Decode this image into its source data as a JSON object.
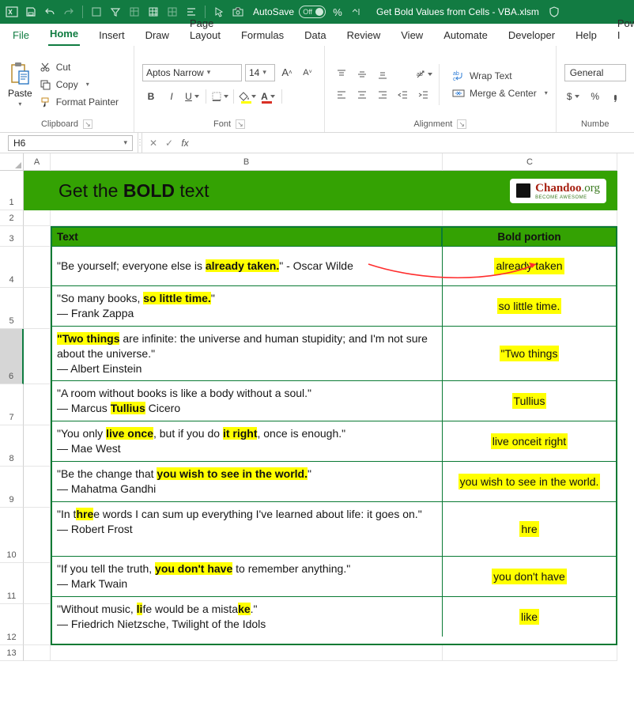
{
  "titlebar": {
    "autosave_label": "AutoSave",
    "autosave_state": "Off",
    "percent_icon": "%",
    "document_title": "Get Bold Values from Cells - VBA.xlsm"
  },
  "menutabs": {
    "file": "File",
    "home": "Home",
    "insert": "Insert",
    "draw": "Draw",
    "page_layout": "Page Layout",
    "formulas": "Formulas",
    "data": "Data",
    "review": "Review",
    "view": "View",
    "automate": "Automate",
    "developer": "Developer",
    "help": "Help",
    "power": "Power I"
  },
  "ribbon": {
    "clipboard": {
      "label": "Clipboard",
      "paste": "Paste",
      "cut": "Cut",
      "copy": "Copy",
      "format_painter": "Format Painter"
    },
    "font": {
      "label": "Font",
      "name": "Aptos Narrow",
      "size": "14",
      "bold": "B",
      "italic": "I",
      "underline": "U",
      "font_letter": "A"
    },
    "alignment": {
      "label": "Alignment",
      "wrap": "Wrap Text",
      "merge": "Merge & Center"
    },
    "number": {
      "label": "Numbe",
      "format": "General",
      "currency": "$",
      "percent": "%"
    }
  },
  "namebox": "H6",
  "formula": "",
  "colheaders": {
    "A": "A",
    "B": "B",
    "C": "C"
  },
  "rowheaders": [
    "1",
    "2",
    "3",
    "4",
    "5",
    "6",
    "7",
    "8",
    "9",
    "10",
    "11",
    "12",
    "13"
  ],
  "banner": {
    "pre": "Get the ",
    "bold": "BOLD",
    "post": " text",
    "logo_name": "Chandoo",
    "logo_tld": ".org",
    "logo_sub": "BECOME AWESOME"
  },
  "table": {
    "headers": {
      "text": "Text",
      "bold": "Bold portion"
    },
    "rows": [
      {
        "pre": "\"Be yourself; everyone else is ",
        "hl": "already taken.",
        "post": "\" - Oscar Wilde",
        "result": "already taken"
      },
      {
        "pre": "\"So many books, ",
        "hl": "so little time.",
        "post": "\"",
        "author": "― Frank Zappa",
        "result": "so little time."
      },
      {
        "pre": "",
        "hl": "\"Two things",
        "post": " are infinite: the universe and human stupidity; and I'm not sure about the universe.\"",
        "author": "― Albert Einstein",
        "result": "\"Two things"
      },
      {
        "pre": "\"A room without books is like a body without a soul.\"",
        "author_pre": "― Marcus ",
        "hl": "Tullius",
        "author_post": " Cicero",
        "result": "Tullius"
      },
      {
        "pre": "\"You only ",
        "hl": "live once",
        "mid": ", but if you do ",
        "hl2": "it right",
        "post": ", once is enough.\"",
        "author": "― Mae West",
        "result": "live onceit right"
      },
      {
        "pre": "\"Be the change that ",
        "hl": "you wish to see in the world.",
        "post": "\"",
        "author": "― Mahatma Gandhi",
        "result": "you wish to see in the world."
      },
      {
        "pre": "\"In t",
        "hl": "hre",
        "post": "e words I can sum up everything I've learned about life: it goes on.\"",
        "author": "― Robert Frost",
        "result": "hre"
      },
      {
        "pre": "\"If you tell the truth, ",
        "hl": "you don't have",
        "post": " to remember anything.\"",
        "author": "― Mark Twain",
        "result": "you don't have"
      },
      {
        "pre": "\"Without music, ",
        "hl": "li",
        "mid": "fe would be a mista",
        "hl2": "ke",
        "post": ".\"",
        "author": "― Friedrich Nietzsche, Twilight of the Idols",
        "result": "like"
      }
    ]
  }
}
